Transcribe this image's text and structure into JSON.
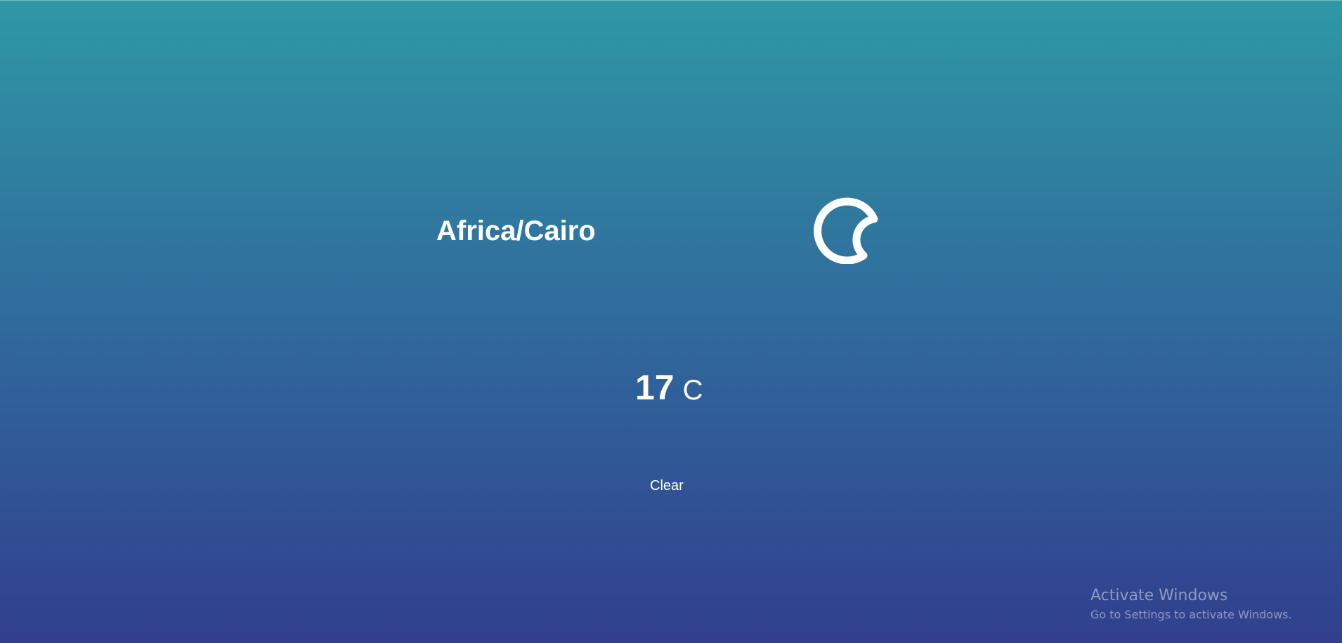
{
  "weather": {
    "timezone": "Africa/Cairo",
    "icon": "moon-icon",
    "temperature": "17",
    "unit": "C"
  },
  "actions": {
    "clear_label": "Clear"
  },
  "watermark": {
    "title": "Activate Windows",
    "subtitle": "Go to Settings to activate Windows."
  },
  "colors": {
    "gradient_top": "#2e98a4",
    "gradient_bottom": "#313f8d",
    "text": "#ffffff"
  }
}
